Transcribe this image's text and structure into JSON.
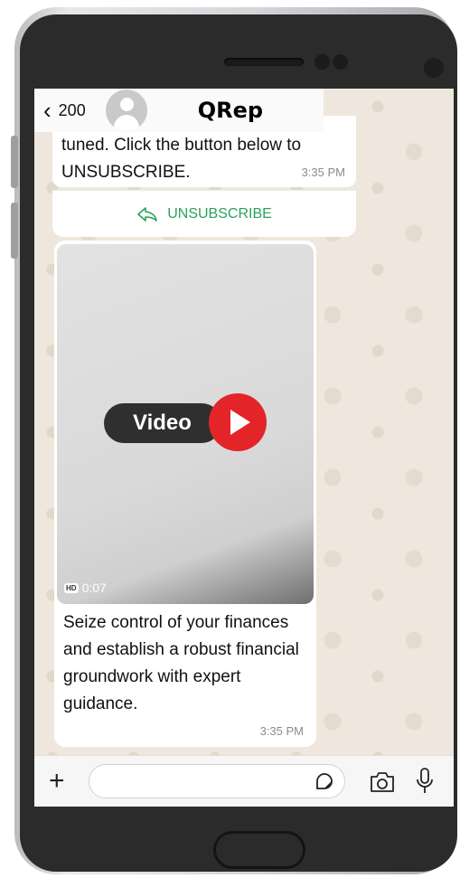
{
  "header": {
    "back_count": "200",
    "contact_name": "QRep"
  },
  "messages": {
    "first": {
      "text": "tuned. Click the button below to UNSUBSCRIBE.",
      "time": "3:35 PM",
      "button_label": "UNSUBSCRIBE"
    },
    "second": {
      "video_label": "Video",
      "video_quality": "HD",
      "video_duration": "0:07",
      "text": "Seize control of your finances and establish a robust financial groundwork with expert guidance.",
      "time": "3:35 PM"
    }
  },
  "composer": {
    "input_value": ""
  },
  "colors": {
    "chat_background": "#efe7dd",
    "bubble": "#ffffff",
    "accent_green": "#2aa15d",
    "play_red": "#e3252a"
  },
  "icons": [
    "chevron-left-icon",
    "avatar-icon",
    "reply-icon",
    "play-icon",
    "hd-icon",
    "plus-icon",
    "sticker-icon",
    "camera-icon",
    "mic-icon"
  ]
}
